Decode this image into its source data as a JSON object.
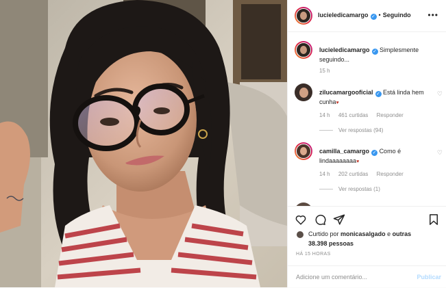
{
  "post": {
    "username": "lucieledicamargo",
    "follow_status": "Seguindo",
    "separator": "•",
    "more_icon": "more-horizontal-icon"
  },
  "comments": [
    {
      "username": "lucieledicamargo",
      "text": "Simplesmente seguindo...",
      "time": "15 h"
    },
    {
      "username": "zilucamargooficial",
      "text": "Está linda hem cunha",
      "time": "14 h",
      "likes": "461 curtidas",
      "reply_label": "Responder",
      "view_replies": "Ver respostas (94)"
    },
    {
      "username": "camilla_camargo",
      "text": "Como é lindaaaaaaaa",
      "time": "14 h",
      "likes": "202 curtidas",
      "reply_label": "Responder",
      "view_replies": "Ver respostas (1)"
    }
  ],
  "footer": {
    "liked_prefix": "Curtido por",
    "liked_user": "monicasalgado",
    "liked_joiner": "e",
    "liked_others": "outras 38.398 pessoas",
    "time_ago": "HÁ 15 HORAS",
    "comment_placeholder": "Adicione um comentário...",
    "publish_label": "Publicar"
  },
  "colors": {
    "verified": "#3897f0",
    "publish_disabled": "#b3dbff",
    "muted_text": "#8e8e8e"
  }
}
